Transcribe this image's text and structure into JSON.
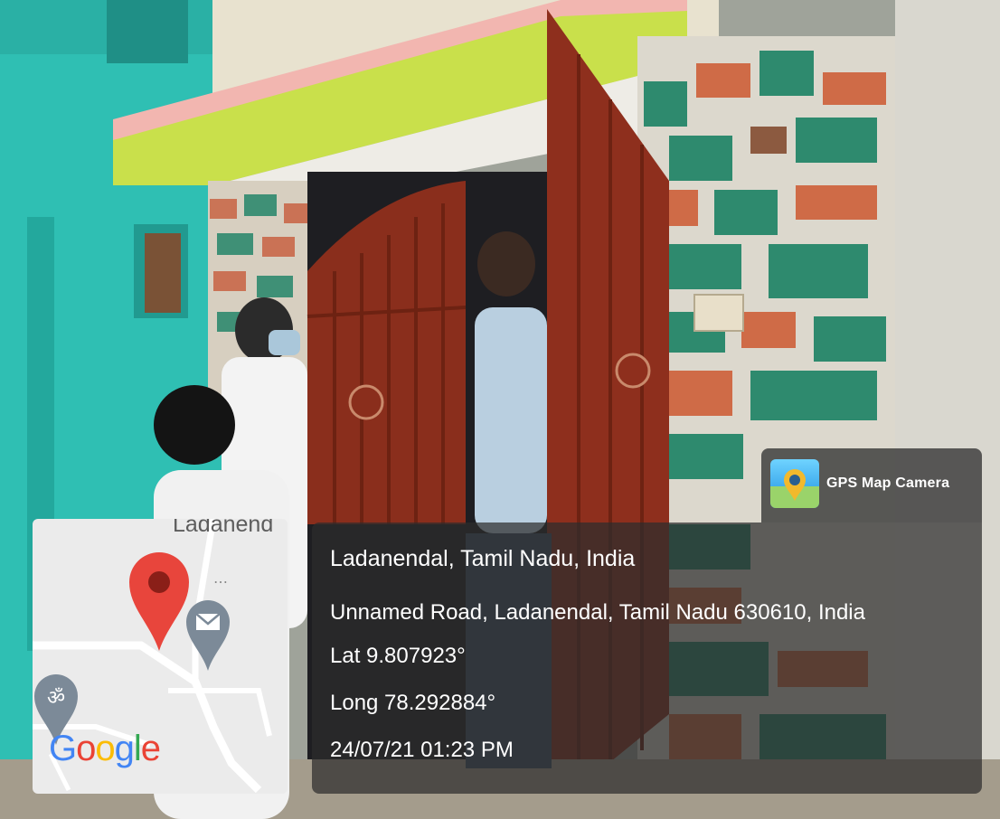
{
  "overlay": {
    "app_name": "GPS Map Camera",
    "location_title": "Ladanendal, Tamil Nadu, India",
    "address": "Unnamed Road, Ladanendal, Tamil Nadu 630610, India",
    "latitude": "Lat 9.807923°",
    "longitude": "Long 78.292884°",
    "timestamp": "24/07/21 01:23 PM"
  },
  "map": {
    "place_label": "Ladanend",
    "logo_letters": [
      "G",
      "o",
      "o",
      "g",
      "l",
      "e"
    ],
    "logo_colors": [
      "#4285F4",
      "#EA4335",
      "#FBBC05",
      "#4285F4",
      "#34A853",
      "#EA4335"
    ],
    "pin_color": "#e8453c",
    "markers": [
      "location-pin-icon",
      "mail-marker-icon",
      "om-marker-icon"
    ]
  },
  "icons": [
    "gps-map-camera-app-icon"
  ]
}
